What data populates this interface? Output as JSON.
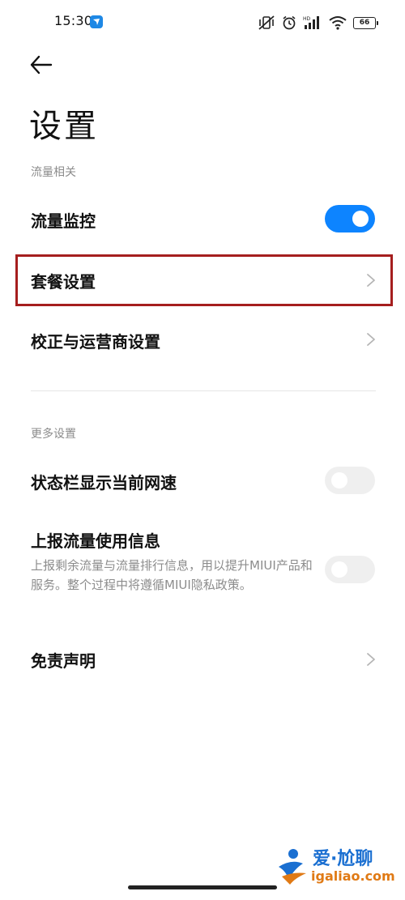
{
  "status_bar": {
    "time": "15:30",
    "battery": "66"
  },
  "page": {
    "title": "设置"
  },
  "sections": {
    "traffic": {
      "label": "流量相关",
      "monitor_label": "流量监控",
      "monitor_enabled": true,
      "plan_settings_label": "套餐设置",
      "carrier_settings_label": "校正与运营商设置"
    },
    "more": {
      "label": "更多设置",
      "show_speed_label": "状态栏显示当前网速",
      "show_speed_enabled": false,
      "report_label": "上报流量使用信息",
      "report_desc": "上报剩余流量与流量排行信息，用以提升MIUI产品和服务。整个过程中将遵循MIUI隐私政策。",
      "report_enabled": false,
      "disclaimer_label": "免责声明"
    }
  },
  "watermark": {
    "brand": "爱·尬聊",
    "url": "igaliao.com"
  },
  "colors": {
    "accent": "#0d84ff",
    "highlight_border": "#a51e1e",
    "secondary_text": "#8c8c8c"
  }
}
